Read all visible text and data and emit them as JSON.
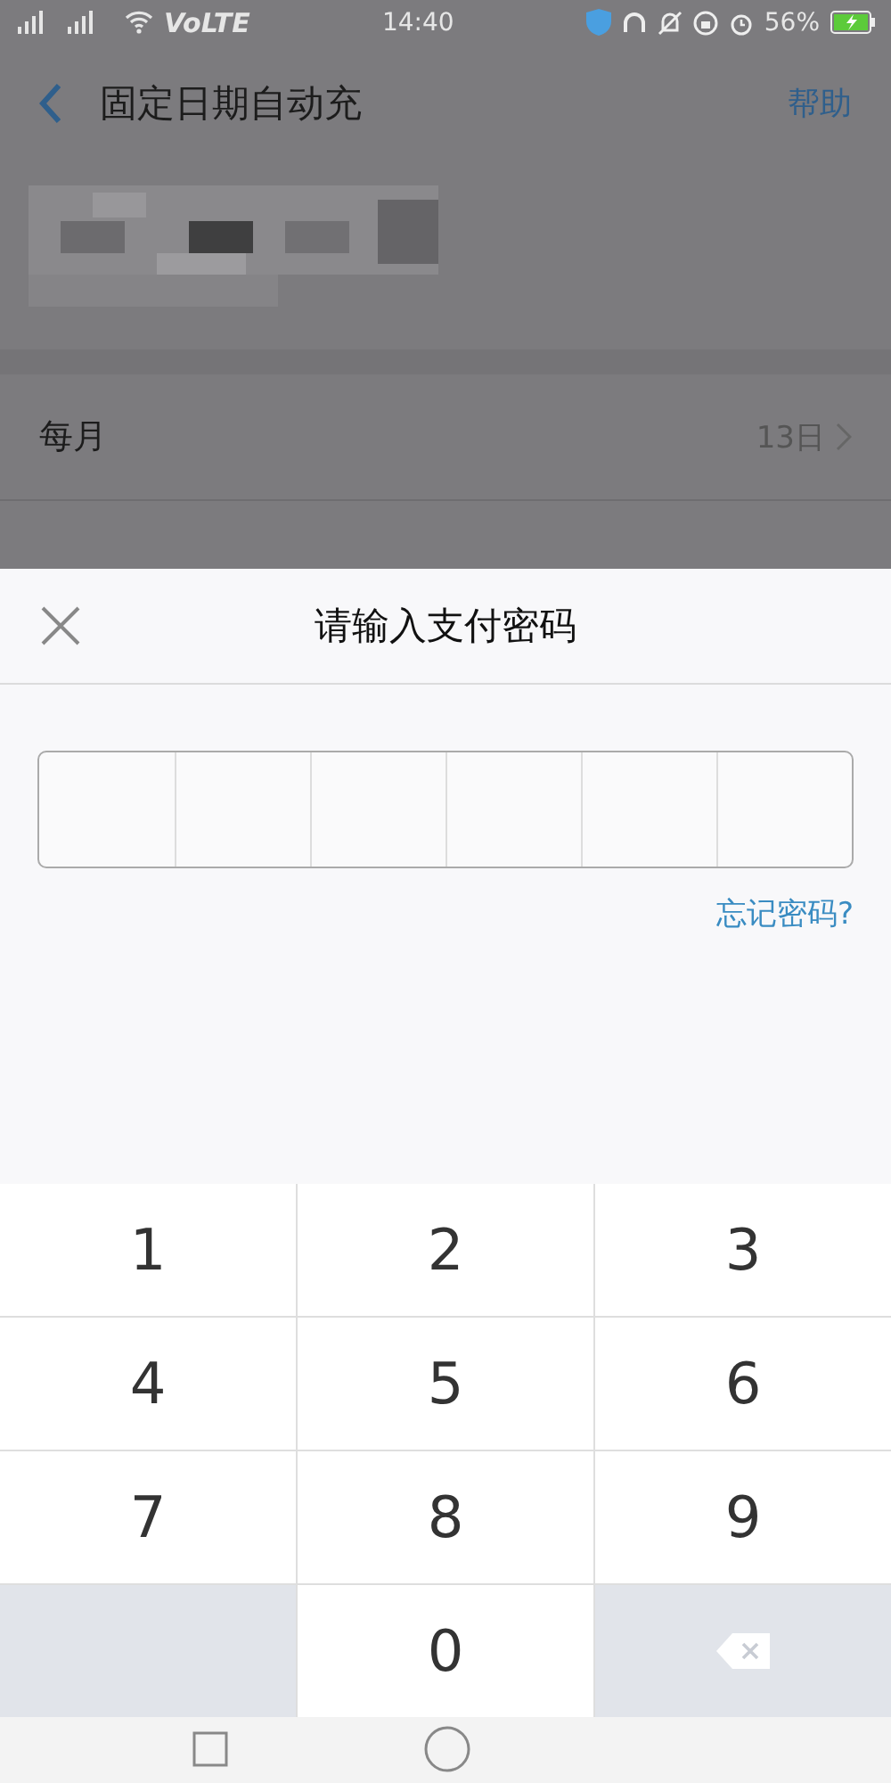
{
  "status_bar": {
    "carrier": "VoLTE",
    "time": "14:40",
    "battery": "56%"
  },
  "header": {
    "title": "固定日期自动充",
    "action": "帮助"
  },
  "rows": [
    {
      "label": "每月",
      "value": "13日"
    }
  ],
  "sheet": {
    "title": "请输入支付密码",
    "forgot": "忘记密码?"
  },
  "keypad": [
    {
      "kind": "digit",
      "label": "1"
    },
    {
      "kind": "digit",
      "label": "2"
    },
    {
      "kind": "digit",
      "label": "3"
    },
    {
      "kind": "digit",
      "label": "4"
    },
    {
      "kind": "digit",
      "label": "5"
    },
    {
      "kind": "digit",
      "label": "6"
    },
    {
      "kind": "digit",
      "label": "7"
    },
    {
      "kind": "digit",
      "label": "8"
    },
    {
      "kind": "digit",
      "label": "9"
    },
    {
      "kind": "blank"
    },
    {
      "kind": "digit",
      "label": "0"
    },
    {
      "kind": "delete"
    }
  ]
}
